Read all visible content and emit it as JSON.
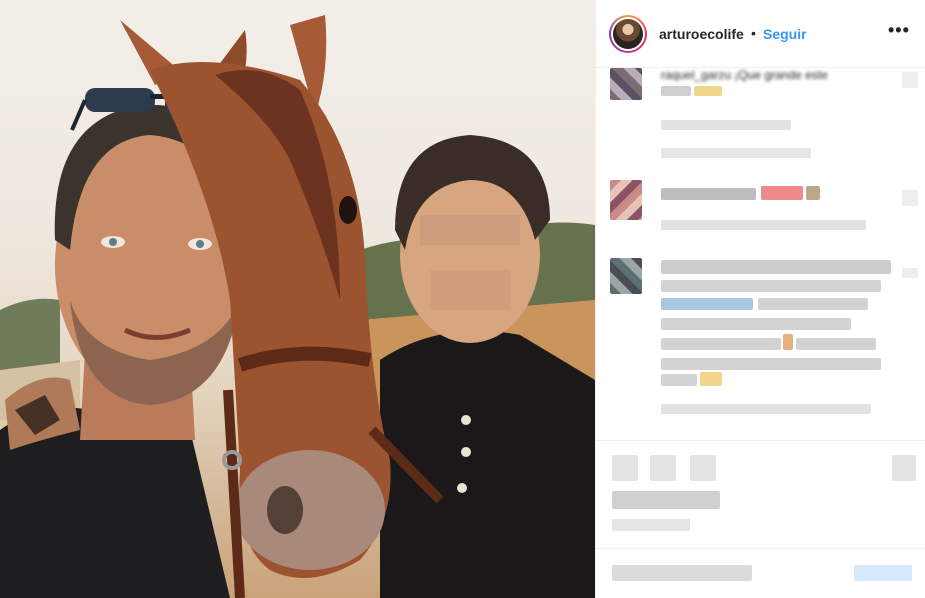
{
  "header": {
    "username": "arturoecolife",
    "separator": "•",
    "follow_label": "Seguir",
    "more_icon": "more-options-icon"
  },
  "comments": [
    {
      "text": "raquel_garzu ¡Que grande este"
    }
  ],
  "colors": {
    "link": "#3897f0",
    "text": "#262626",
    "border": "#efefef"
  }
}
